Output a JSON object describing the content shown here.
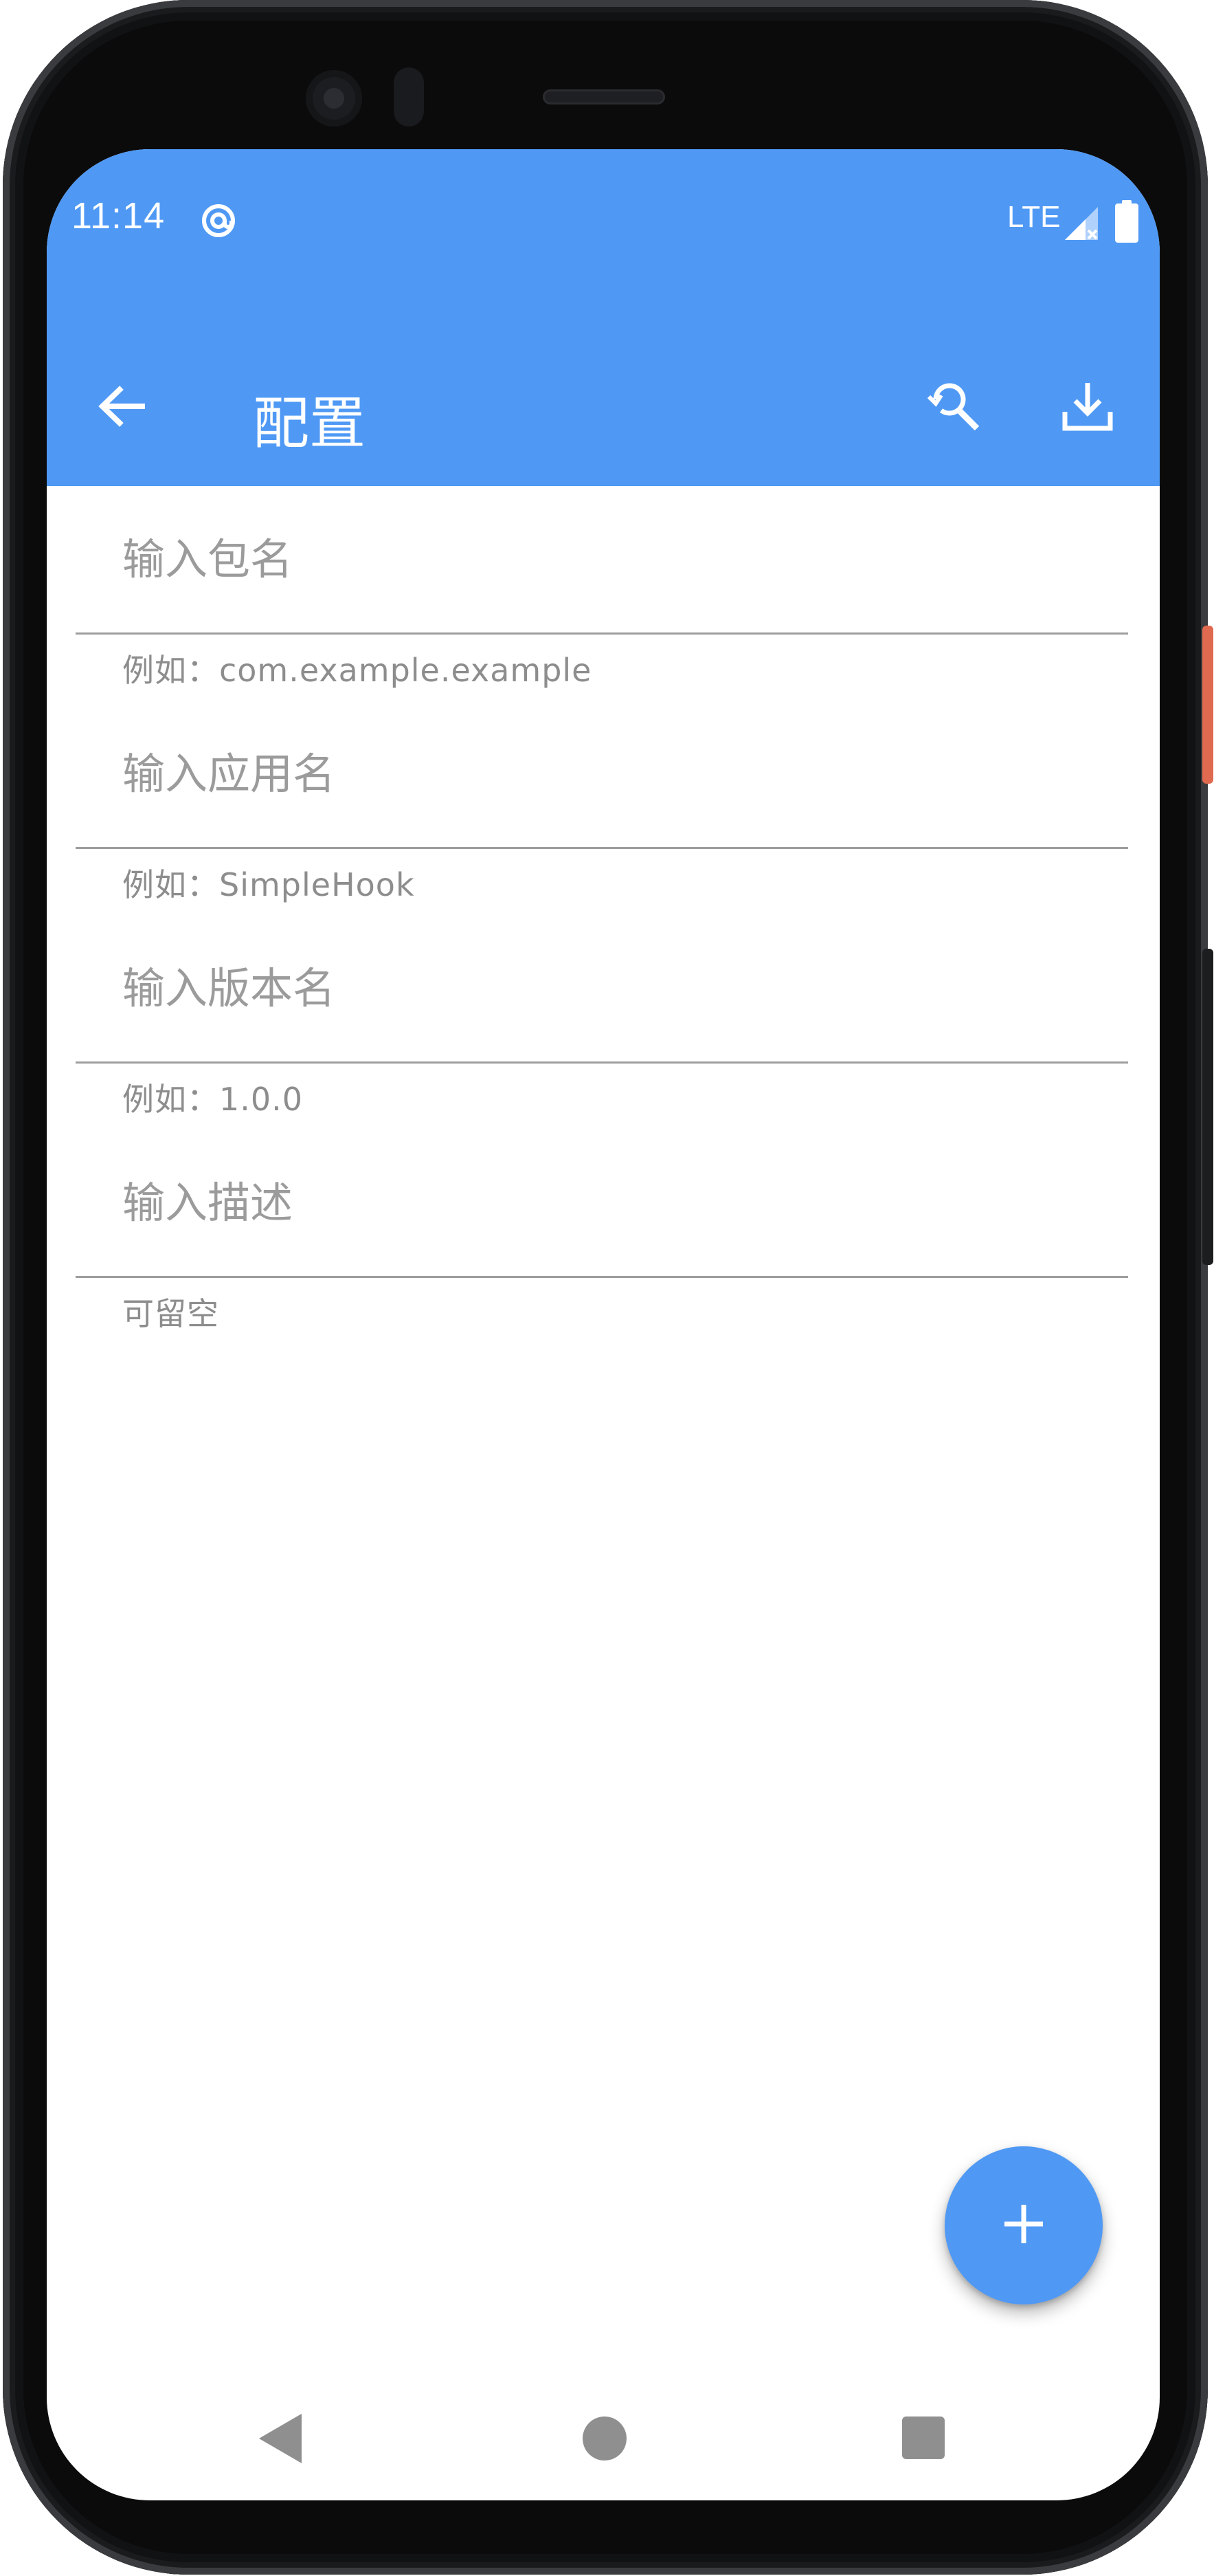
{
  "status_bar": {
    "time": "11:14",
    "network": "LTE",
    "icons": [
      "at-sign-icon",
      "signal-icon",
      "battery-icon"
    ]
  },
  "toolbar": {
    "title": "配置",
    "back_icon": "arrow-left-icon",
    "actions": [
      "search-history-icon",
      "download-icon"
    ]
  },
  "form": {
    "fields": [
      {
        "placeholder": "输入包名",
        "helper": "例如：com.example.example",
        "value": ""
      },
      {
        "placeholder": "输入应用名",
        "helper": "例如：SimpleHook",
        "value": ""
      },
      {
        "placeholder": "输入版本名",
        "helper": "例如：1.0.0",
        "value": ""
      },
      {
        "placeholder": "输入描述",
        "helper": "可留空",
        "value": ""
      }
    ]
  },
  "fab": {
    "icon": "plus-icon"
  },
  "nav_bar": {
    "icons": [
      "nav-back-icon",
      "nav-home-icon",
      "nav-recents-icon"
    ]
  },
  "colors": {
    "primary": "#4f99f5",
    "on_primary": "#ffffff",
    "hint": "#9b9b9b",
    "helper": "#8d8d8d",
    "divider": "#9e9e9e",
    "nav_icons": "#8f8f8f"
  }
}
